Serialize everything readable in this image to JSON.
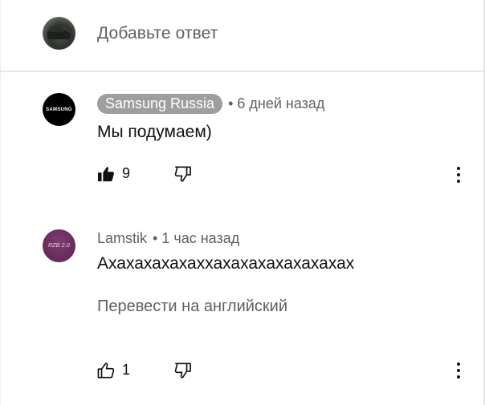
{
  "reply": {
    "placeholder": "Добавьте ответ"
  },
  "comments": [
    {
      "author": "Samsung Russia",
      "author_is_channel_owner": true,
      "avatar_text": "SAMSUNG",
      "separator": "•",
      "time": "6 дней назад",
      "text": "Мы подумаем)",
      "likes": "9",
      "liked": true
    },
    {
      "author": "Lamstik",
      "author_is_channel_owner": false,
      "avatar_text": "RZB 2.0",
      "separator": "•",
      "time": "1 час назад",
      "text": "Ахахахахахаххахахахахахахахах",
      "translate_label": "Перевести на английский",
      "likes": "1",
      "liked": false
    }
  ],
  "colors": {
    "badge": "#9e9e9e",
    "secondary_text": "#606060",
    "primary_text": "#0f0f0f",
    "divider": "#e8e8e8"
  },
  "icons": [
    "thumbs-up-filled-icon",
    "thumbs-up-outline-icon",
    "thumbs-down-outline-icon",
    "more-vertical-icon"
  ]
}
